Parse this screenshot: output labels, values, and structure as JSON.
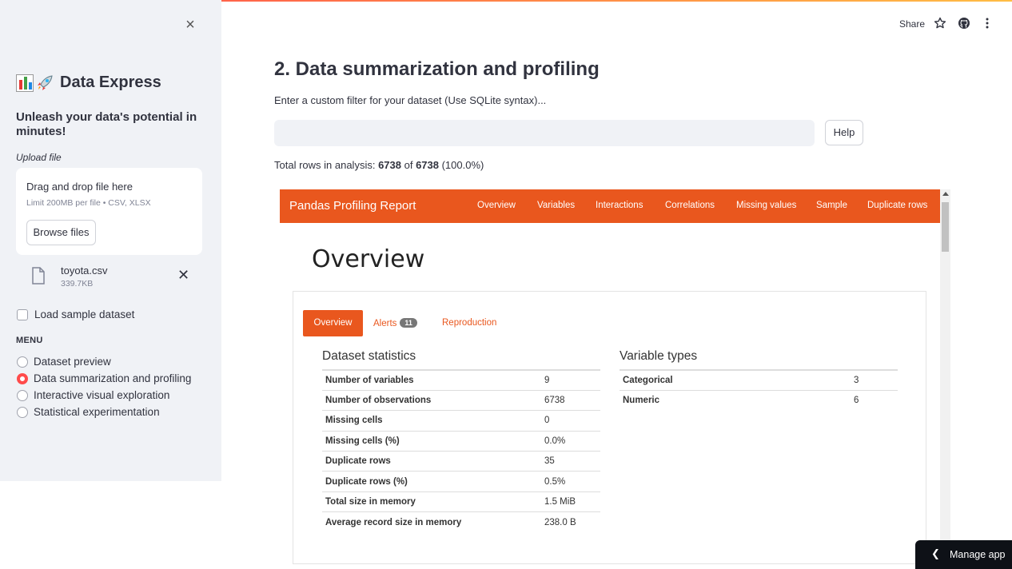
{
  "sidebar": {
    "title": "Data Express",
    "subtitle": "Unleash your data's potential in minutes!",
    "upload_label": "Upload file",
    "dropzone": {
      "main": "Drag and drop file here",
      "limit": "Limit 200MB per file • CSV, XLSX",
      "browse": "Browse files"
    },
    "file": {
      "name": "toyota.csv",
      "size": "339.7KB"
    },
    "sample_checkbox": "Load sample dataset",
    "menu_heading": "MENU",
    "menu_items": [
      {
        "label": "Dataset preview",
        "selected": false
      },
      {
        "label": "Data summarization and profiling",
        "selected": true
      },
      {
        "label": "Interactive visual exploration",
        "selected": false
      },
      {
        "label": "Statistical experimentation",
        "selected": false
      }
    ]
  },
  "header": {
    "share": "Share"
  },
  "main": {
    "title": "2. Data summarization and profiling",
    "filter_label": "Enter a custom filter for your dataset (Use SQLite syntax)...",
    "filter_value": "",
    "help": "Help",
    "total_rows": {
      "prefix": "Total rows in analysis: ",
      "rows": "6738",
      "of": " of ",
      "total": "6738",
      "pct": " (100.0%)"
    }
  },
  "report": {
    "brand": "Pandas Profiling Report",
    "nav": [
      "Overview",
      "Variables",
      "Interactions",
      "Correlations",
      "Missing values",
      "Sample",
      "Duplicate rows"
    ],
    "heading": "Overview",
    "tabs": {
      "overview": "Overview",
      "alerts": "Alerts",
      "alerts_count": "11",
      "reproduction": "Reproduction"
    },
    "dataset_stats_title": "Dataset statistics",
    "dataset_stats": [
      {
        "k": "Number of variables",
        "v": "9"
      },
      {
        "k": "Number of observations",
        "v": "6738"
      },
      {
        "k": "Missing cells",
        "v": "0"
      },
      {
        "k": "Missing cells (%)",
        "v": "0.0%"
      },
      {
        "k": "Duplicate rows",
        "v": "35"
      },
      {
        "k": "Duplicate rows (%)",
        "v": "0.5%"
      },
      {
        "k": "Total size in memory",
        "v": "1.5 MiB"
      },
      {
        "k": "Average record size in memory",
        "v": "238.0 B"
      }
    ],
    "variable_types_title": "Variable types",
    "variable_types": [
      {
        "k": "Categorical",
        "v": "3"
      },
      {
        "k": "Numeric",
        "v": "6"
      }
    ]
  },
  "manage_app": "Manage app"
}
